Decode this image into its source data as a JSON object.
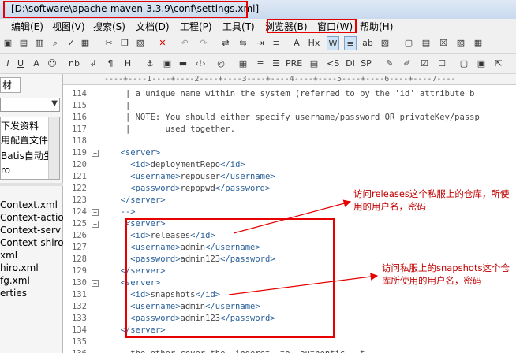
{
  "window": {
    "title": "[D:\\software\\apache-maven-3.3.9\\conf\\settings.xml]"
  },
  "menu": {
    "items": [
      "编辑(E)",
      "视图(V)",
      "搜索(S)",
      "文档(D)",
      "工程(P)",
      "工具(T)",
      "浏览器(B)",
      "窗口(W)",
      "帮助(H)"
    ]
  },
  "toolbar2": {
    "labels": [
      "U",
      "A",
      "nb",
      "¶",
      "H",
      "PRE",
      "<S",
      "DI",
      "SP"
    ]
  },
  "sidebar": {
    "tab_label": "材",
    "tree_top": [
      "下发资料",
      "用配置文件",
      "Batis自动生",
      "ro"
    ],
    "files": [
      "Context.xml",
      "Context-actio",
      "Context-serv",
      "Context-shiro",
      "xml",
      "hiro.xml",
      "fg.xml",
      "erties"
    ]
  },
  "ruler": {
    "text": "----+----1----+----2----+----3----+----4----+----5----+----6----+----7----"
  },
  "editor": {
    "lines": [
      {
        "num": "114",
        "fold": "",
        "text": "   | a unique name within the system (referred to by the 'id' attribute b"
      },
      {
        "num": "115",
        "fold": "",
        "text": "   |"
      },
      {
        "num": "116",
        "fold": "",
        "text": "   | NOTE: You should either specify username/password OR privateKey/passp"
      },
      {
        "num": "117",
        "fold": "",
        "text": "   |       used together."
      },
      {
        "num": "118",
        "fold": "",
        "text": ""
      },
      {
        "num": "119",
        "fold": "−",
        "text": "  <server>"
      },
      {
        "num": "120",
        "fold": "",
        "text": "    <id>deploymentRepo</id>"
      },
      {
        "num": "121",
        "fold": "",
        "text": "    <username>repouser</username>"
      },
      {
        "num": "122",
        "fold": "",
        "text": "    <password>repopwd</password>"
      },
      {
        "num": "123",
        "fold": "",
        "text": "  </server>"
      },
      {
        "num": "124",
        "fold": "−",
        "text": "  -->"
      },
      {
        "num": "125",
        "fold": "−",
        "text": "   <server>"
      },
      {
        "num": "126",
        "fold": "",
        "text": "    <id>releases</id>"
      },
      {
        "num": "127",
        "fold": "",
        "text": "    <username>admin</username>"
      },
      {
        "num": "128",
        "fold": "",
        "text": "    <password>admin123</password>"
      },
      {
        "num": "129",
        "fold": "",
        "text": "  </server>"
      },
      {
        "num": "130",
        "fold": "−",
        "text": "  <server>"
      },
      {
        "num": "131",
        "fold": "",
        "text": "    <id>snapshots</id>"
      },
      {
        "num": "132",
        "fold": "",
        "text": "    <username>admin</username>"
      },
      {
        "num": "133",
        "fold": "",
        "text": "    <password>admin123</password>"
      },
      {
        "num": "134",
        "fold": "",
        "text": "  </server>"
      },
      {
        "num": "135",
        "fold": "",
        "text": ""
      },
      {
        "num": "136",
        "fold": "",
        "text": "    the ether cover the  inderet  to  authentic   t"
      }
    ]
  },
  "annotations": {
    "releases": [
      "访问releases这个私服上的仓库，所使",
      "用的用户名，密码"
    ],
    "snapshots": [
      "访问私服上的snapshots这个仓",
      "库所使用的用户名，密码"
    ]
  },
  "colors": {
    "highlight": "#e60000",
    "annotation": "#c00000",
    "tag": "#2a6099"
  }
}
